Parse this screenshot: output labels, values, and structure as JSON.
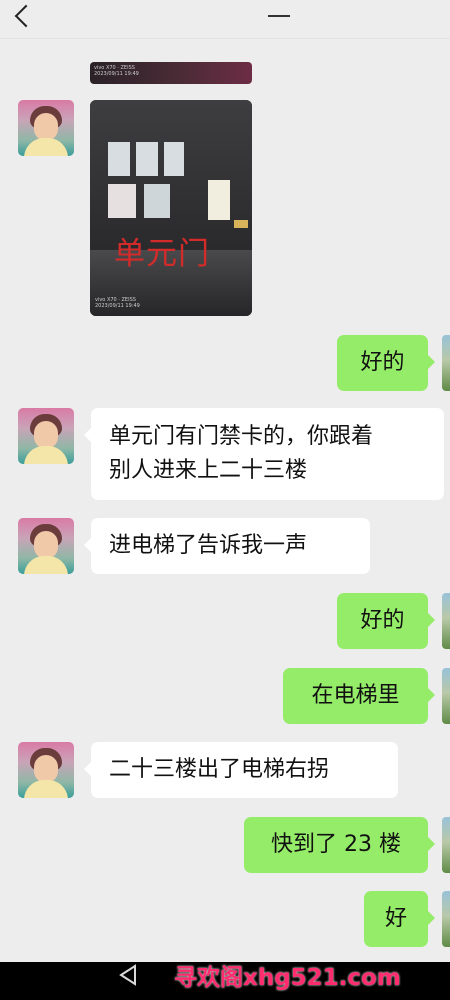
{
  "header": {
    "title_fragment": ""
  },
  "messages": [
    {
      "kind": "image",
      "side": "incoming",
      "watermark": "vivo X70 · ZEISS\n2023/09/11 19:49"
    },
    {
      "kind": "image",
      "side": "incoming",
      "caption": "单元门",
      "watermark": "vivo X70 · ZEISS\n2023/09/11 19:49"
    },
    {
      "kind": "text",
      "side": "outgoing",
      "text": "好的"
    },
    {
      "kind": "text",
      "side": "incoming",
      "line1": "单元门有门禁卡的，你跟着",
      "line2": "别人进来上二十三楼"
    },
    {
      "kind": "text",
      "side": "incoming",
      "text": "进电梯了告诉我一声"
    },
    {
      "kind": "text",
      "side": "outgoing",
      "text": "好的"
    },
    {
      "kind": "text",
      "side": "outgoing",
      "text": "在电梯里"
    },
    {
      "kind": "text",
      "side": "incoming",
      "text": "二十三楼出了电梯右拐"
    },
    {
      "kind": "text",
      "side": "outgoing",
      "text": "快到了 23 楼"
    },
    {
      "kind": "text",
      "side": "outgoing",
      "text": "好"
    }
  ],
  "watermark_text": "寻欢阁xhg521.com",
  "colors": {
    "outgoing_bubble": "#95ec69",
    "incoming_bubble": "#ffffff",
    "background": "#ededed",
    "watermark": "#ff2c6e"
  },
  "icons": {
    "back": "chevron-left-icon",
    "nav_back": "triangle-back-icon"
  }
}
